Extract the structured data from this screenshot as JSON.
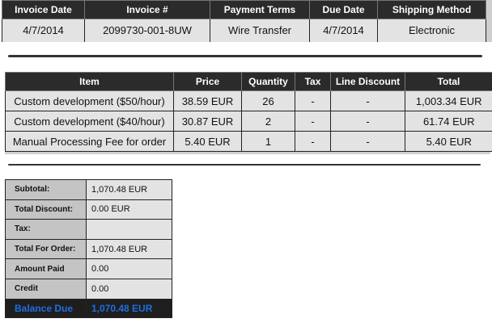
{
  "invoice_header": {
    "columns": [
      "Invoice Date",
      "Invoice #",
      "Payment Terms",
      "Due Date",
      "Shipping Method"
    ],
    "values": [
      "4/7/2014",
      "2099730-001-8UW",
      "Wire Transfer",
      "4/7/2014",
      "Electronic"
    ]
  },
  "items": {
    "columns": [
      "Item",
      "Price",
      "Quantity",
      "Tax",
      "Line Discount",
      "Total"
    ],
    "rows": [
      [
        "Custom development ($50/hour)",
        "38.59 EUR",
        "26",
        "-",
        "-",
        "1,003.34 EUR"
      ],
      [
        "Custom development ($40/hour)",
        "30.87 EUR",
        "2",
        "-",
        "-",
        "61.74 EUR"
      ],
      [
        "Manual Processing Fee for order",
        "5.40 EUR",
        "1",
        "-",
        "-",
        "5.40 EUR"
      ]
    ]
  },
  "totals": {
    "rows": [
      {
        "label": "Subtotal:",
        "value": "1,070.48 EUR"
      },
      {
        "label": "Total Discount:",
        "value": "0.00 EUR"
      },
      {
        "label": "Tax:",
        "value": ""
      },
      {
        "label": "Total For Order:",
        "value": "1,070.48 EUR"
      },
      {
        "label": "Amount Paid",
        "value": "0.00"
      },
      {
        "label": "Credit",
        "value": "0.00"
      }
    ],
    "balance": {
      "label": "Balance Due",
      "value": "1,070.48 EUR"
    }
  },
  "colors": {
    "header_bg": "#2b2b2b",
    "cell_bg": "#e3e3e3",
    "label_bg": "#c4c4c4",
    "balance_text": "#1f6fe0"
  }
}
